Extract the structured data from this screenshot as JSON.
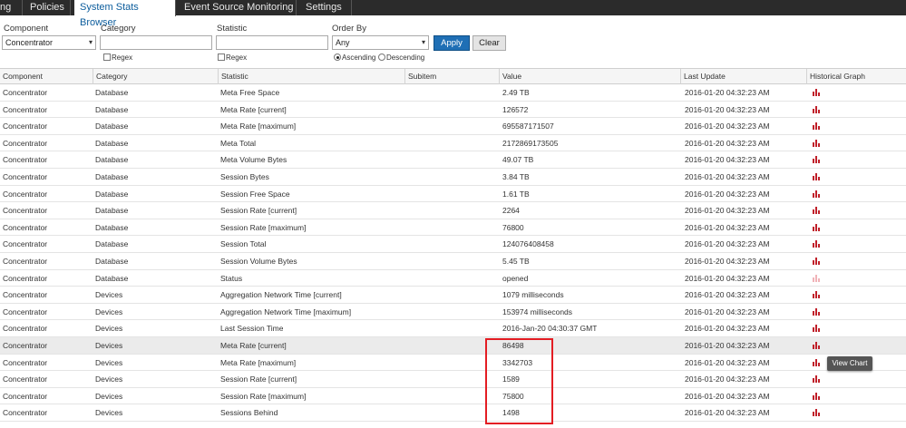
{
  "tabs": [
    {
      "label": "ng",
      "active": false
    },
    {
      "label": "Policies",
      "active": false
    },
    {
      "label": "System Stats Browser",
      "active": true
    },
    {
      "label": "Event Source Monitoring",
      "active": false
    },
    {
      "label": "Settings",
      "active": false
    }
  ],
  "filters": {
    "component_label": "Component",
    "component_value": "Concentrator",
    "category_label": "Category",
    "category_value": "",
    "category_regex": "Regex",
    "statistic_label": "Statistic",
    "statistic_value": "",
    "statistic_regex": "Regex",
    "orderby_label": "Order By",
    "orderby_value": "Any",
    "ascending_label": "Ascending",
    "descending_label": "Descending",
    "ascending_selected": true,
    "apply_label": "Apply",
    "clear_label": "Clear"
  },
  "table": {
    "headers": [
      "Component",
      "Category",
      "Statistic",
      "Subitem",
      "Value",
      "Last Update",
      "Historical Graph"
    ],
    "rows": [
      {
        "component": "Concentrator",
        "category": "Database",
        "statistic": "Meta Free Space",
        "subitem": "",
        "value": "2.49 TB",
        "last_update": "2016-01-20 04:32:23 AM",
        "graph": "bar-chart-icon"
      },
      {
        "component": "Concentrator",
        "category": "Database",
        "statistic": "Meta Rate [current]",
        "subitem": "",
        "value": "126572",
        "last_update": "2016-01-20 04:32:23 AM",
        "graph": "bar-chart-icon"
      },
      {
        "component": "Concentrator",
        "category": "Database",
        "statistic": "Meta Rate [maximum]",
        "subitem": "",
        "value": "695587171507",
        "last_update": "2016-01-20 04:32:23 AM",
        "graph": "bar-chart-icon"
      },
      {
        "component": "Concentrator",
        "category": "Database",
        "statistic": "Meta Total",
        "subitem": "",
        "value": "2172869173505",
        "last_update": "2016-01-20 04:32:23 AM",
        "graph": "bar-chart-icon"
      },
      {
        "component": "Concentrator",
        "category": "Database",
        "statistic": "Meta Volume Bytes",
        "subitem": "",
        "value": "49.07 TB",
        "last_update": "2016-01-20 04:32:23 AM",
        "graph": "bar-chart-icon"
      },
      {
        "component": "Concentrator",
        "category": "Database",
        "statistic": "Session Bytes",
        "subitem": "",
        "value": "3.84 TB",
        "last_update": "2016-01-20 04:32:23 AM",
        "graph": "bar-chart-icon"
      },
      {
        "component": "Concentrator",
        "category": "Database",
        "statistic": "Session Free Space",
        "subitem": "",
        "value": "1.61 TB",
        "last_update": "2016-01-20 04:32:23 AM",
        "graph": "bar-chart-icon"
      },
      {
        "component": "Concentrator",
        "category": "Database",
        "statistic": "Session Rate [current]",
        "subitem": "",
        "value": "2264",
        "last_update": "2016-01-20 04:32:23 AM",
        "graph": "bar-chart-icon"
      },
      {
        "component": "Concentrator",
        "category": "Database",
        "statistic": "Session Rate [maximum]",
        "subitem": "",
        "value": "76800",
        "last_update": "2016-01-20 04:32:23 AM",
        "graph": "bar-chart-icon"
      },
      {
        "component": "Concentrator",
        "category": "Database",
        "statistic": "Session Total",
        "subitem": "",
        "value": "124076408458",
        "last_update": "2016-01-20 04:32:23 AM",
        "graph": "bar-chart-icon"
      },
      {
        "component": "Concentrator",
        "category": "Database",
        "statistic": "Session Volume Bytes",
        "subitem": "",
        "value": "5.45 TB",
        "last_update": "2016-01-20 04:32:23 AM",
        "graph": "bar-chart-icon"
      },
      {
        "component": "Concentrator",
        "category": "Database",
        "statistic": "Status",
        "subitem": "",
        "value": "opened",
        "last_update": "2016-01-20 04:32:23 AM",
        "graph": "bar-chart-icon-disabled"
      },
      {
        "component": "Concentrator",
        "category": "Devices",
        "statistic": "Aggregation Network Time [current]",
        "subitem": "",
        "value": "1079 milliseconds",
        "last_update": "2016-01-20 04:32:23 AM",
        "graph": "bar-chart-icon"
      },
      {
        "component": "Concentrator",
        "category": "Devices",
        "statistic": "Aggregation Network Time [maximum]",
        "subitem": "",
        "value": "153974 milliseconds",
        "last_update": "2016-01-20 04:32:23 AM",
        "graph": "bar-chart-icon"
      },
      {
        "component": "Concentrator",
        "category": "Devices",
        "statistic": "Last Session Time",
        "subitem": "",
        "value": "2016-Jan-20 04:30:37 GMT",
        "last_update": "2016-01-20 04:32:23 AM",
        "graph": "bar-chart-icon"
      },
      {
        "component": "Concentrator",
        "category": "Devices",
        "statistic": "Meta Rate [current]",
        "subitem": "",
        "value": "86498",
        "last_update": "2016-01-20 04:32:23 AM",
        "graph": "bar-chart-icon",
        "highlighted": true
      },
      {
        "component": "Concentrator",
        "category": "Devices",
        "statistic": "Meta Rate [maximum]",
        "subitem": "",
        "value": "3342703",
        "last_update": "2016-01-20 04:32:23 AM",
        "graph": "bar-chart-icon"
      },
      {
        "component": "Concentrator",
        "category": "Devices",
        "statistic": "Session Rate [current]",
        "subitem": "",
        "value": "1589",
        "last_update": "2016-01-20 04:32:23 AM",
        "graph": "bar-chart-icon"
      },
      {
        "component": "Concentrator",
        "category": "Devices",
        "statistic": "Session Rate [maximum]",
        "subitem": "",
        "value": "75800",
        "last_update": "2016-01-20 04:32:23 AM",
        "graph": "bar-chart-icon"
      },
      {
        "component": "Concentrator",
        "category": "Devices",
        "statistic": "Sessions Behind",
        "subitem": "",
        "value": "1498",
        "last_update": "2016-01-20 04:32:23 AM",
        "graph": "bar-chart-icon"
      }
    ]
  },
  "tooltip": {
    "label": "View Chart"
  },
  "colors": {
    "accent": "#1f6fb5",
    "tab_bar": "#2b2b2b",
    "graph_icon": "#c0202a",
    "highlight_box": "#e31d23"
  }
}
